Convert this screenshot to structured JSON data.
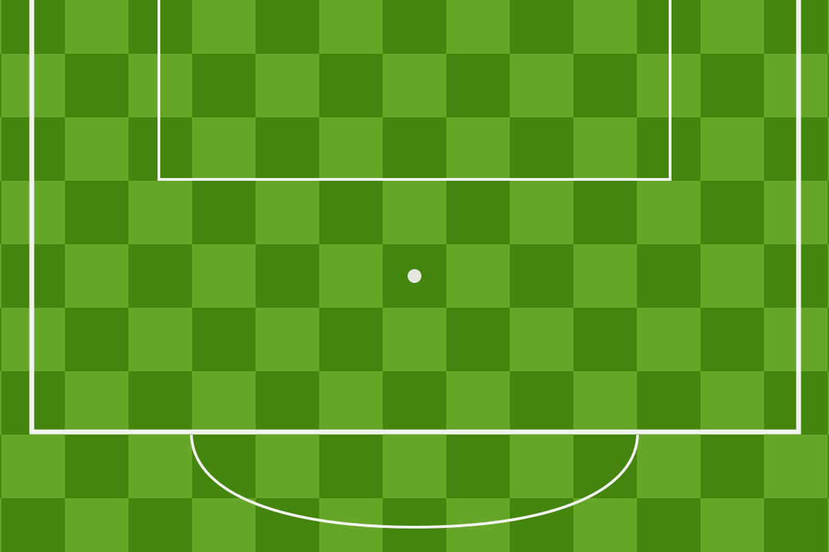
{
  "pitch": {
    "colors": {
      "grass_light": "#66a729",
      "grass_dark": "#44850d",
      "line": "#f3f3ef",
      "ball": "#e6e6e0"
    },
    "checkerboard": true
  },
  "markings": {
    "penalty_area": "visible",
    "goal_area": "visible",
    "penalty_arc": "visible",
    "penalty_spot": "visible"
  }
}
